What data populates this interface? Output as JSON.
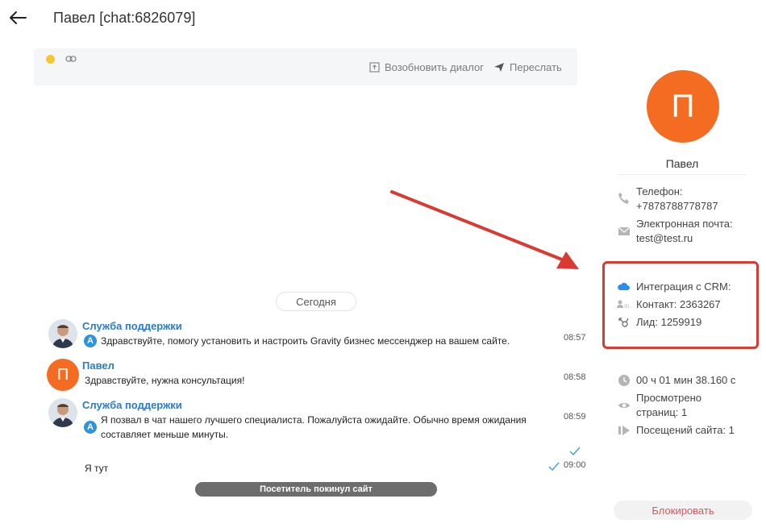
{
  "header": {
    "title": "Павел [chat:6826079]"
  },
  "toolbar": {
    "renew_label": "Возобновить диалог",
    "forward_label": "Переслать"
  },
  "chat": {
    "date_divider": "Сегодня",
    "messages": [
      {
        "author": "Служба поддержки",
        "text": "Здравствуйте, помогу установить и настроить Gravity бизнес мессенджер на вашем сайте.",
        "time": "08:57",
        "badge": "A"
      },
      {
        "author": "Павел",
        "avatar_letter": "П",
        "text": "Здравствуйте, нужна консультация!",
        "time": "08:58"
      },
      {
        "author": "Служба поддержки",
        "text_line1": "Я позвал в чат нашего лучшего специалиста. Пожалуйста ожидайте. Обычно время ожидания",
        "text_line2": "составляет меньше минуты.",
        "time": "08:59",
        "badge": "A"
      },
      {
        "text": "Я тут",
        "time": "09:00"
      }
    ],
    "system_notice": "Посетитель покинул сайт"
  },
  "profile": {
    "avatar_letter": "П",
    "name": "Павел",
    "phone_label": "Телефон:",
    "phone_value": "+7878788778787",
    "email_label": "Электронная почта:",
    "email_value": "test@test.ru"
  },
  "crm": {
    "title": "Интеграция с CRM:",
    "contact": "Контакт: 2363267",
    "lead": "Лид: 1259919",
    "highlight_color": "#d93a32"
  },
  "stats": {
    "duration": "00 ч 01 мин 38.160 с",
    "viewed_line1": "Просмотрено",
    "viewed_line2": "страниц: 1",
    "visits": "Посещений сайта: 1"
  },
  "actions": {
    "block_label": "Блокировать"
  },
  "colors": {
    "accent": "#2a7bd0",
    "avatar_orange": "#f36c21",
    "status_yellow": "#f6c534",
    "arrow_red": "#d93a32"
  }
}
